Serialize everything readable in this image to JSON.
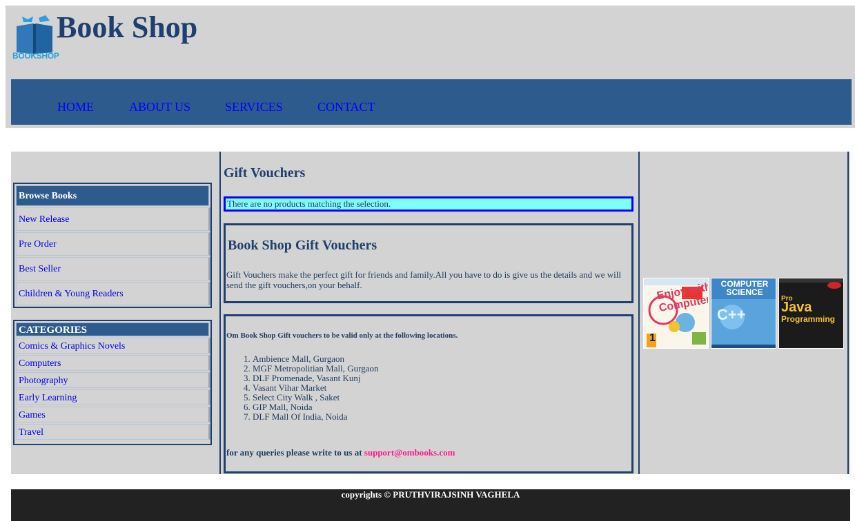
{
  "header": {
    "site_title": "Book Shop",
    "logo_text": "BOOKSHOP",
    "logo_icon": "book-icon"
  },
  "nav": {
    "items": [
      {
        "label": "HOME"
      },
      {
        "label": "ABOUT US"
      },
      {
        "label": "SERVICES"
      },
      {
        "label": "CONTACT"
      }
    ]
  },
  "sidebar": {
    "browse": {
      "title": "Browse Books",
      "items": [
        {
          "label": "New Release"
        },
        {
          "label": "Pre Order"
        },
        {
          "label": "Best Seller"
        },
        {
          "label": "Children & Young Readers"
        }
      ]
    },
    "categories": {
      "title": "CATEGORIES",
      "items": [
        {
          "label": "Comics & Graphics Novels"
        },
        {
          "label": "Computers"
        },
        {
          "label": "Photography"
        },
        {
          "label": "Early Learning"
        },
        {
          "label": "Games"
        },
        {
          "label": "Travel"
        }
      ]
    }
  },
  "content": {
    "heading": "Gift Vouchers",
    "no_products_message": "There are no products matching the selection.",
    "vouchers": {
      "title": "Book Shop Gift Vouchers",
      "description": "Gift Vouchers make the perfect gift for friends and family.All you have to do is give us the details and we will send the gift vouchers,on your behalf."
    },
    "locations": {
      "intro": "Om Book Shop Gift vouchers to be valid only at the following locations.",
      "items": [
        "Ambience Mall, Gurgaon",
        "MGF Metropolitian Mall, Gurgaon",
        "DLF Promenade, Vasant Kunj",
        "Vasant Vihar Market",
        "Select City Walk , Saket",
        "GIP Mall, Noida",
        "DLF Mall Of India, Noida"
      ],
      "queries_text": "for any queries please write to us at",
      "support_email": "support@ombooks.com"
    }
  },
  "books": [
    {
      "name": "enjoy-with-computers-book",
      "title_text": "Enjoy with Computers",
      "number": "1"
    },
    {
      "name": "computer-science-cpp-book",
      "title_text": "COMPUTER SCIENCE",
      "subtitle": "C++"
    },
    {
      "name": "pro-java-programming-book",
      "title_text": "Java",
      "pre": "Pro",
      "subtitle": "Programming"
    }
  ],
  "footer": {
    "copyright": "copyrights © PRUTHVIRAJSINH VAGHELA"
  },
  "colors": {
    "header_bg": "#d3d3d3",
    "nav_bg": "#2d5b8e",
    "nav_link": "#0000ff",
    "border": "#1f3f6e",
    "notice_bg": "#80ffff",
    "email": "#ff1a8c",
    "footer_bg": "#222222"
  }
}
